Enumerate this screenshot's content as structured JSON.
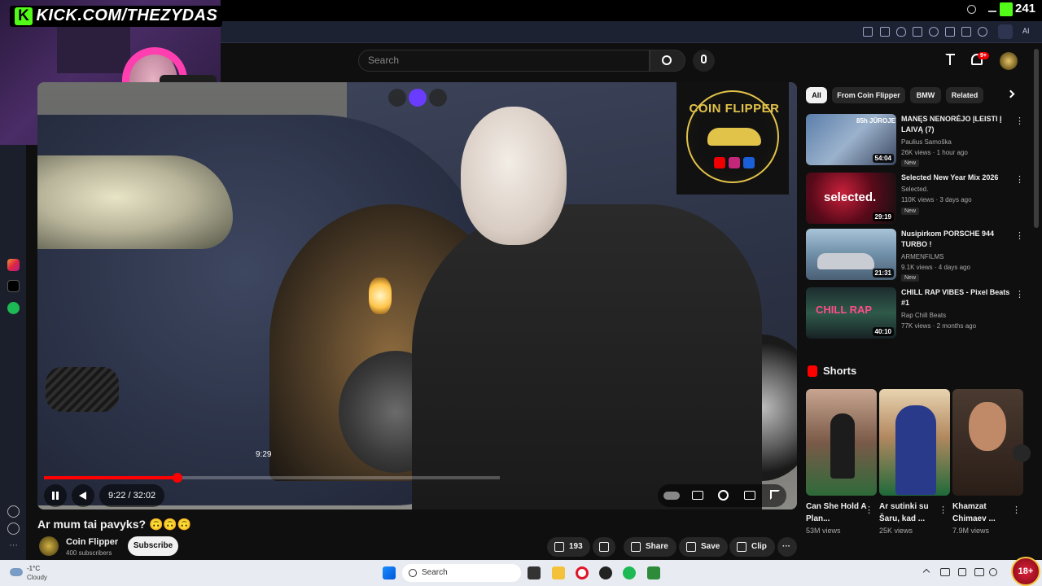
{
  "stream_overlay": {
    "kick_url": "KICK.COM/THEZYDAS",
    "viewer_count": "241"
  },
  "header": {
    "search_placeholder": "Search",
    "notif_badge": "9+"
  },
  "player": {
    "hover_time": "9:29",
    "time_display": "9:22 / 32:02",
    "progress_fraction": 0.293,
    "badge_text": "COIN FLIPPER"
  },
  "video": {
    "title": "Ar mum tai pavyks? 🙃🙃🙃",
    "channel_name": "Coin Flipper",
    "subscribers": "400 subscribers",
    "subscribe_label": "Subscribe",
    "likes": "193",
    "share_label": "Share",
    "save_label": "Save",
    "clip_label": "Clip"
  },
  "chips": [
    "All",
    "From Coin Flipper",
    "BMW",
    "Related"
  ],
  "recommendations": [
    {
      "title": "MANĘS NENORĖJO ĮLEISTI Į LAIVĄ (7)",
      "channel": "Paulius Samoška",
      "meta": "26K views · 1 hour ago",
      "badge": "New",
      "duration": "54:04",
      "thumb_text": "85h JŪROJE"
    },
    {
      "title": "Selected New Year Mix 2026",
      "channel": "Selected.",
      "meta": "110K views · 3 days ago",
      "badge": "New",
      "duration": "29:19",
      "thumb_text": "selected."
    },
    {
      "title": "Nusipirkom PORSCHE 944 TURBO !",
      "channel": "ARMENFILMS",
      "meta": "9.1K views · 4 days ago",
      "badge": "New",
      "duration": "21:31",
      "thumb_text": ""
    },
    {
      "title": "CHILL RAP VIBES - Pixel Beats #1",
      "channel": "Rap Chill Beats",
      "meta": "77K views · 2 months ago",
      "badge": "",
      "duration": "40:10",
      "thumb_text": "CHILL RAP"
    }
  ],
  "shorts": {
    "label": "Shorts",
    "items": [
      {
        "title": "Can She Hold A Plan...",
        "views": "53M views"
      },
      {
        "title": "Ar sutinki su Šaru, kad ...",
        "views": "25K views"
      },
      {
        "title": "Khamzat Chimaev ...",
        "views": "7.9M views"
      }
    ]
  },
  "taskbar": {
    "temp": "-1°C",
    "condition": "Cloudy",
    "search": "Search",
    "age_badge": "18+"
  },
  "colors": {
    "accent_red": "#ff0000",
    "kick_green": "#53fc18",
    "coin_gold": "#e2c34a"
  }
}
